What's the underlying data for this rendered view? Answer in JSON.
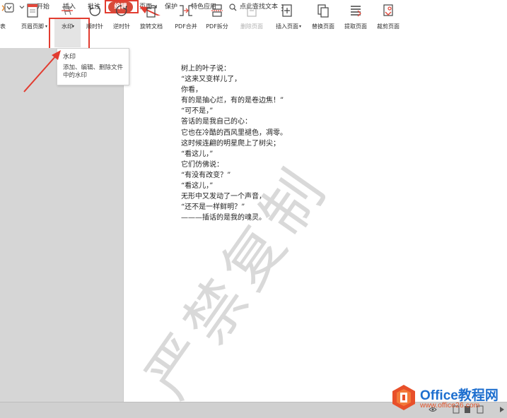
{
  "menu": {
    "items": [
      "开始",
      "插入",
      "批注",
      "编辑",
      "页面",
      "保护",
      "特色应用"
    ],
    "active": "编辑",
    "search_placeholder": "点此查找文本"
  },
  "toolbar": {
    "items": [
      {
        "label": "表",
        "icon": "partial-tool-icon",
        "enabled": true
      },
      {
        "label": "页眉页脚",
        "icon": "header-footer-icon",
        "enabled": true,
        "dropdown": true
      },
      {
        "label": "水印",
        "icon": "watermark-icon",
        "enabled": true,
        "dropdown": true
      },
      {
        "label": "顺时针",
        "icon": "rotate-clockwise-icon",
        "enabled": true
      },
      {
        "label": "逆时针",
        "icon": "rotate-counterclockwise-icon",
        "enabled": true
      },
      {
        "label": "旋转文档",
        "icon": "rotate-document-icon",
        "enabled": true
      },
      {
        "label": "PDF合并",
        "icon": "pdf-merge-icon",
        "enabled": true
      },
      {
        "label": "PDF拆分",
        "icon": "pdf-split-icon",
        "enabled": true
      },
      {
        "label": "删除页面",
        "icon": "delete-page-icon",
        "enabled": false
      },
      {
        "label": "插入页面",
        "icon": "insert-page-icon",
        "enabled": true,
        "dropdown": true
      },
      {
        "label": "替换页面",
        "icon": "replace-page-icon",
        "enabled": true
      },
      {
        "label": "提取页面",
        "icon": "extract-page-icon",
        "enabled": true
      },
      {
        "label": "裁剪页面",
        "icon": "crop-page-icon",
        "enabled": true
      }
    ]
  },
  "tooltip": {
    "title": "水印",
    "description": "添加、编辑、删除文件中的水印"
  },
  "document": {
    "lines": [
      "树上的叶子说：",
      "“这来又变样儿了，",
      "你看，",
      "有的是抽心烂，有的是卷边焦！”",
      "“可不是，”",
      "答话的是我自己的心：",
      "它也在冷酷的西风里褪色，凋零。",
      "这时候连翩的明星爬上了树尖；",
      "“看这儿，”",
      "它们仿佛说：",
      "“有没有改变？”",
      "“看这儿，”",
      "无形中又发动了一个声音，",
      "“还不是一样鲜明？”",
      "———插话的是我的魂灵。"
    ],
    "watermark": "严禁复制"
  },
  "brand": {
    "title": "Office教程网",
    "url": "www.office26.com"
  },
  "colors": {
    "accent_red": "#e23c30",
    "tab_active_bg": "#d84a3a",
    "brand_blue": "#1e6fcf",
    "brand_orange": "#e2572e",
    "watermark_gray": "#d9d9d9"
  }
}
